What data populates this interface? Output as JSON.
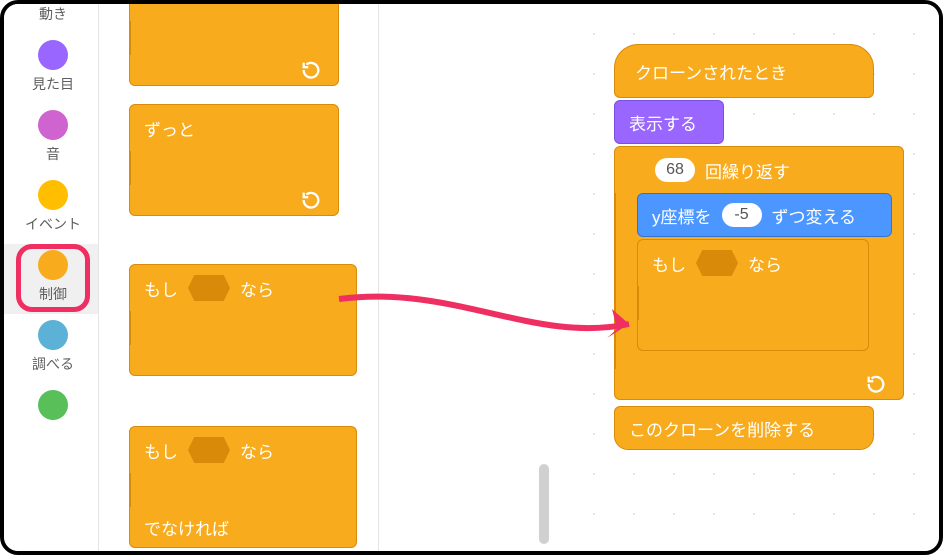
{
  "categories": [
    {
      "id": "motion",
      "label": "動き",
      "color": "#4c97ff"
    },
    {
      "id": "looks",
      "label": "見た目",
      "color": "#9966ff"
    },
    {
      "id": "sound",
      "label": "音",
      "color": "#cf63cf"
    },
    {
      "id": "events",
      "label": "イベント",
      "color": "#ffbf00"
    },
    {
      "id": "control",
      "label": "制御",
      "color": "#f8ab1c"
    },
    {
      "id": "sensing",
      "label": "調べる",
      "color": "#5cb1d6"
    },
    {
      "id": "operators",
      "label": "",
      "color": "#59c059"
    }
  ],
  "selected_category": "control",
  "palette": {
    "forever": {
      "label": "ずっと"
    },
    "if": {
      "label_if": "もし",
      "label_then": "なら"
    },
    "ifelse": {
      "label_if": "もし",
      "label_then": "なら",
      "label_else": "でなければ"
    }
  },
  "script": {
    "hat": {
      "label": "クローンされたとき"
    },
    "show": {
      "label": "表示する"
    },
    "repeat": {
      "value": "68",
      "label_suffix": "回繰り返す"
    },
    "changey": {
      "label_prefix": "y座標を",
      "value": "-5",
      "label_suffix": "ずつ変える"
    },
    "if": {
      "label_if": "もし",
      "label_then": "なら"
    },
    "deleteclone": {
      "label": "このクローンを削除する"
    }
  }
}
